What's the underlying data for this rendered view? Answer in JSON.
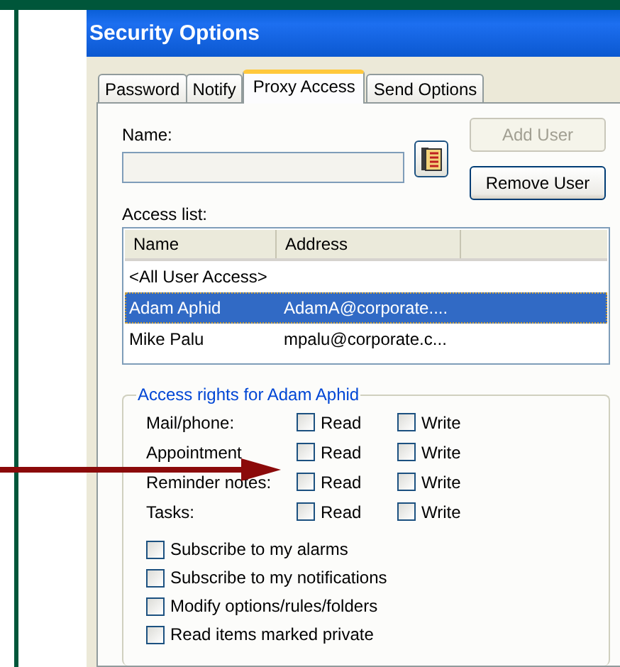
{
  "window": {
    "title": "Security Options"
  },
  "tabs": [
    {
      "label": "Password",
      "selected": false
    },
    {
      "label": "Notify",
      "selected": false
    },
    {
      "label": "Proxy Access",
      "selected": true
    },
    {
      "label": "Send Options",
      "selected": false
    }
  ],
  "name_field": {
    "label": "Name:"
  },
  "address_book_button": {
    "disabled": false
  },
  "buttons": [
    {
      "label": "Add User",
      "disabled": true
    },
    {
      "label": "Remove User",
      "disabled": false
    }
  ],
  "access_list": {
    "label": "Access list:",
    "columns": [
      "Name",
      "Address"
    ],
    "rows": [
      {
        "name": "<All User Access>",
        "address": "",
        "selected": false
      },
      {
        "name": "Adam Aphid",
        "address": "AdamA@corporate....",
        "selected": true
      },
      {
        "name": "Mike Palu",
        "address": "mpalu@corporate.c...",
        "selected": false
      }
    ]
  },
  "access_rights": {
    "title": "Access rights for Adam Aphid",
    "rights": [
      {
        "label": "Mail/phone:",
        "read_label": "Read",
        "read": false,
        "write_label": "Write",
        "write": false
      },
      {
        "label": "Appointment",
        "read_label": "Read",
        "read": false,
        "write_label": "Write",
        "write": false
      },
      {
        "label": "Reminder notes:",
        "read_label": "Read",
        "read": false,
        "write_label": "Write",
        "write": false
      },
      {
        "label": "Tasks:",
        "read_label": "Read",
        "read": false,
        "write_label": "Write",
        "write": false
      }
    ],
    "options": [
      {
        "label": "Subscribe to my alarms",
        "checked": false
      },
      {
        "label": "Subscribe to my notifications",
        "checked": false
      },
      {
        "label": "Modify options/rules/folders",
        "checked": false
      },
      {
        "label": "Read items marked private",
        "checked": false
      }
    ]
  },
  "callout_arrow": {
    "shown": true
  }
}
